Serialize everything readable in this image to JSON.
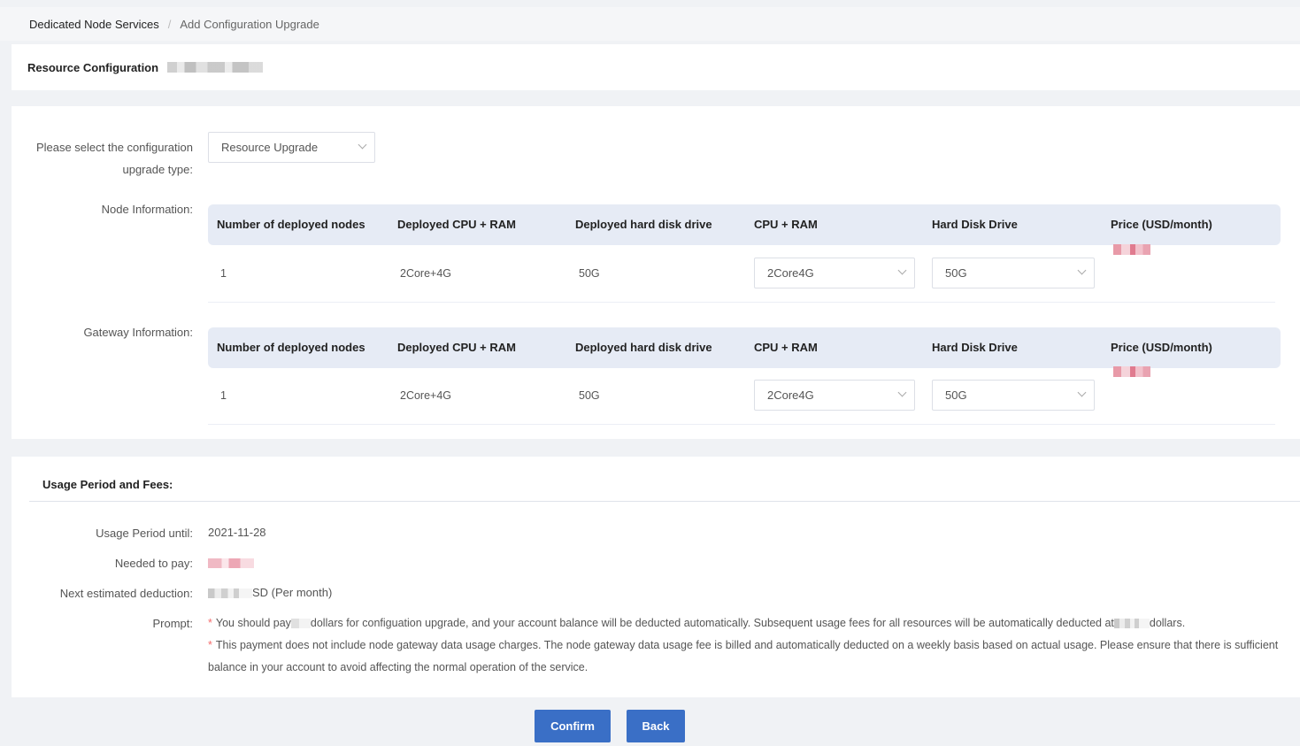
{
  "breadcrumb": {
    "first": "Dedicated Node Services",
    "separator": "/",
    "last": "Add Configuration Upgrade"
  },
  "card_title": "Resource Configuration",
  "upgrade_type": {
    "label_line1": "Please select the configuration",
    "label_line2": "upgrade type:",
    "value": "Resource Upgrade"
  },
  "node_section_label": "Node Information:",
  "gateway_section_label": "Gateway Information:",
  "table_headers": [
    "Number of deployed nodes",
    "Deployed CPU + RAM",
    "Deployed hard disk drive",
    "CPU + RAM",
    "Hard Disk Drive",
    "Price (USD/month)"
  ],
  "node_row": {
    "nodes": "1",
    "deployed_cpu_ram": "2Core+4G",
    "deployed_disk": "50G",
    "cpu_ram_select": "2Core4G",
    "disk_select": "50G"
  },
  "gateway_row": {
    "nodes": "1",
    "deployed_cpu_ram": "2Core+4G",
    "deployed_disk": "50G",
    "cpu_ram_select": "2Core4G",
    "disk_select": "50G"
  },
  "fees": {
    "title": "Usage Period and Fees:",
    "usage_period_label": "Usage Period until:",
    "usage_period_value": "2021-11-28",
    "needed_label": "Needed to pay:",
    "next_label": "Next estimated deduction:",
    "next_suffix": "SD (Per month)",
    "prompt_label": "Prompt:",
    "prompt1_a": "You should pay",
    "prompt1_b": "dollars for configuation upgrade, and your account balance will be deducted automatically. Subsequent usage fees for all resources will be automatically deducted at",
    "prompt1_c": "dollars.",
    "prompt2_line1": "This payment does not include node gateway data usage charges. The node gateway data usage fee is billed and automatically deducted on a weekly basis based on actual usage. Please ensure that there is sufficient",
    "prompt2_line2": "balance in your account to avoid affecting the normal operation of the service."
  },
  "buttons": {
    "confirm": "Confirm",
    "back": "Back"
  }
}
